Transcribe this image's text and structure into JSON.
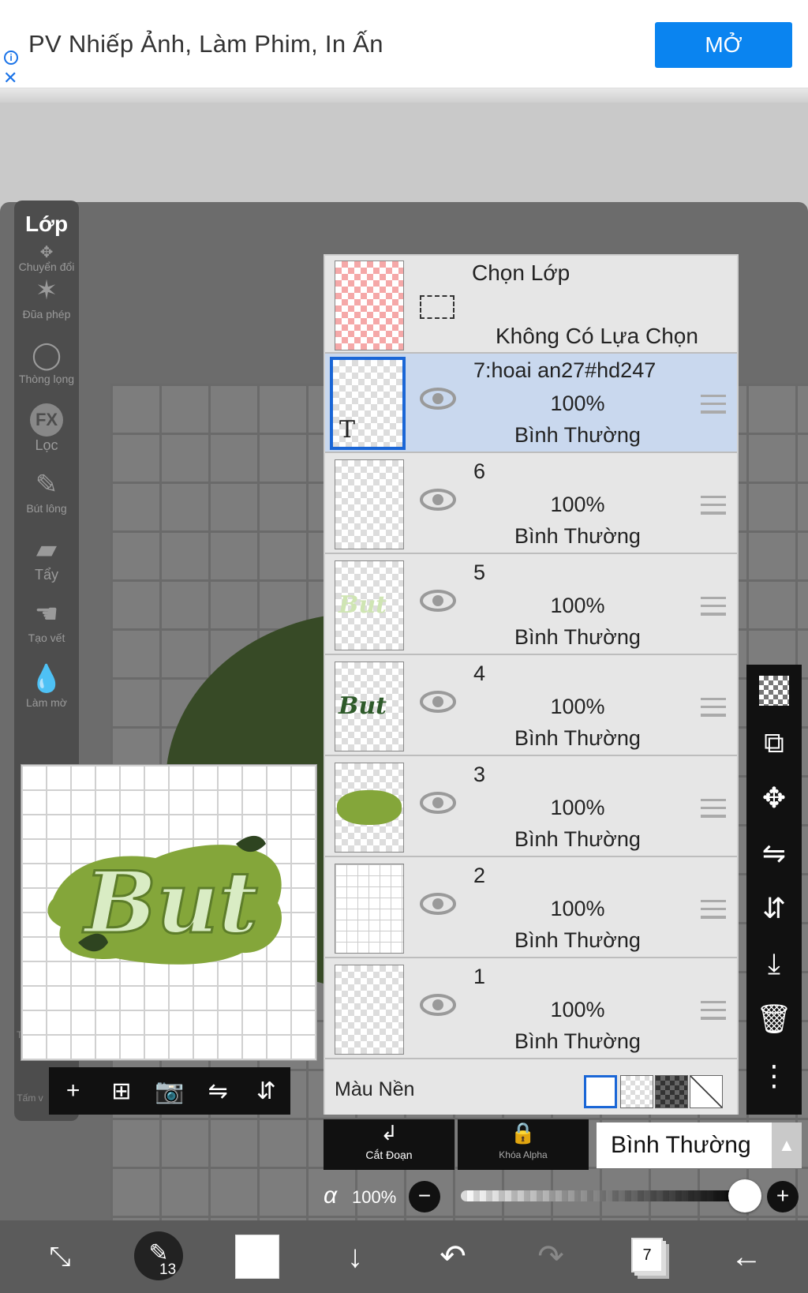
{
  "ad": {
    "info_icon": "info-icon",
    "close_icon": "close-icon",
    "title": "PV Nhiếp Ảnh, Làm Phim, In Ấn",
    "open_label": "MỞ"
  },
  "tools": {
    "layer_label": "Lớp",
    "items": [
      {
        "label": "Chuyển đổi",
        "icon": "move-cross-icon"
      },
      {
        "label": "Đũa phép",
        "icon": "magic-wand-icon"
      },
      {
        "label": "Thòng lọng",
        "icon": "lasso-icon"
      },
      {
        "label": "Lọc",
        "icon": "fx-filter-icon"
      },
      {
        "label": "Bút lông",
        "icon": "brush-icon"
      },
      {
        "label": "Tẩy",
        "icon": "eraser-icon"
      },
      {
        "label": "Tạo vết",
        "icon": "smudge-icon"
      },
      {
        "label": "Làm mờ",
        "icon": "blur-drop-icon"
      }
    ],
    "partial_label_1": "Th",
    "partial_label_2": "Tấm v"
  },
  "preview": {
    "art_text": "But",
    "toolbar": [
      "+",
      "⊞",
      "📷",
      "⇋",
      "⇵"
    ]
  },
  "layers_panel": {
    "selection_row": {
      "title": "Chọn Lớp",
      "subtitle": "Không Có Lựa Chọn"
    },
    "layers": [
      {
        "name": "7:hoai an27#hd247",
        "opacity": "100%",
        "blend": "Bình Thường",
        "selected": true,
        "thumb_text": "T"
      },
      {
        "name": "6",
        "opacity": "100%",
        "blend": "Bình Thường",
        "selected": false
      },
      {
        "name": "5",
        "opacity": "100%",
        "blend": "Bình Thường",
        "selected": false
      },
      {
        "name": "4",
        "opacity": "100%",
        "blend": "Bình Thường",
        "selected": false
      },
      {
        "name": "3",
        "opacity": "100%",
        "blend": "Bình Thường",
        "selected": false
      },
      {
        "name": "2",
        "opacity": "100%",
        "blend": "Bình Thường",
        "selected": false
      },
      {
        "name": "1",
        "opacity": "100%",
        "blend": "Bình Thường",
        "selected": false
      }
    ],
    "background_label": "Màu Nền"
  },
  "right_tools": [
    "checker-icon",
    "transform-icon",
    "move-icon",
    "flip-horizontal-icon",
    "flip-vertical-icon",
    "merge-down-icon",
    "trash-icon",
    "more-vertical-icon"
  ],
  "bottom_controls": {
    "cut_label": "Cắt Đoạn",
    "alpha_lock_label": "Khóa Alpha",
    "blend_mode": "Bình Thường",
    "alpha_symbol": "α",
    "opacity_value": "100%",
    "opacity_fraction": 1.0
  },
  "bottom_nav": {
    "brush_size": "13",
    "layer_count": "7"
  },
  "colors": {
    "accent": "#0a84f0",
    "selected_row": "#c9d8ee",
    "art_green": "#84a63a"
  }
}
